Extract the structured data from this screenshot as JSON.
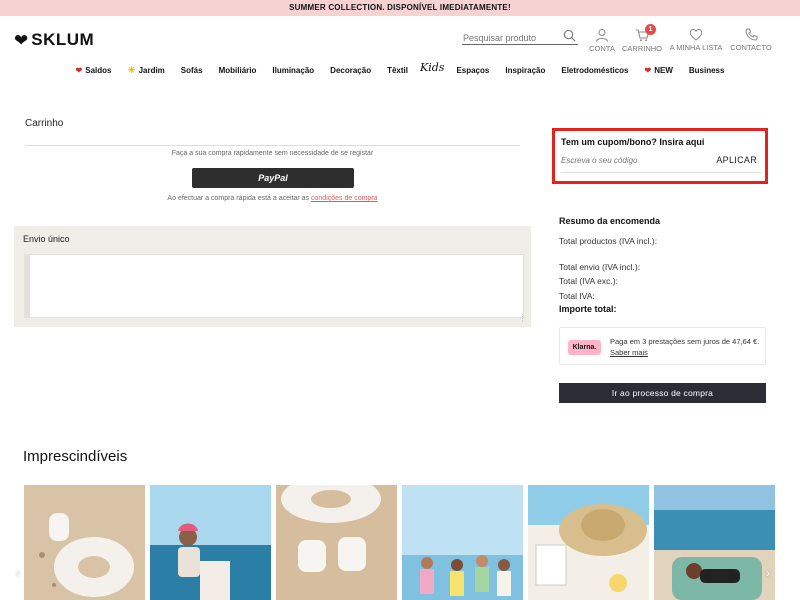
{
  "promo": {
    "text": "SUMMER COLLECTION. DISPONÍVEL IMEDIATAMENTE!"
  },
  "header": {
    "logo": "SKLUM",
    "search_placeholder": "Pesquisar produto",
    "account_label": "CONTA",
    "cart_label": "CARRINHO",
    "cart_count": "1",
    "wishlist_label": "A MINHA LISTA",
    "contact_label": "CONTACTO"
  },
  "nav": {
    "items": [
      {
        "label": "Saldos",
        "mark": "heart"
      },
      {
        "label": "Jardim",
        "mark": "sun"
      },
      {
        "label": "Sofás"
      },
      {
        "label": "Mobiliário"
      },
      {
        "label": "Iluminação"
      },
      {
        "label": "Decoração"
      },
      {
        "label": "Têxtil"
      },
      {
        "label": "Kids"
      },
      {
        "label": "Espaços"
      },
      {
        "label": "Inspiração"
      },
      {
        "label": "Eletrodomésticos"
      },
      {
        "label": "NEW",
        "mark": "heart"
      },
      {
        "label": "Business"
      }
    ]
  },
  "cart": {
    "title": "Carrinho",
    "quick_text": "Faça a sua compra rapidamente sem necessidade de se registar",
    "paypal_label": "PayPal",
    "terms_prefix": "Ao efectuar a compra rápida está a aceitar as ",
    "terms_link": "condições de compra"
  },
  "shipping": {
    "title": "Envio único"
  },
  "coupon": {
    "title": "Tem um cupom/bono? Insira aqui",
    "placeholder": "Escreva o seu código",
    "apply_label": "APLICAR"
  },
  "summary": {
    "title": "Resumo da encomenda",
    "lines": [
      "Total productos (IVA incl.):",
      "Total envio (IVA incl.):",
      "Total (IVA exc.):",
      "Total IVA:"
    ],
    "total_label": "Importe total:"
  },
  "klarna": {
    "logo": "Klarna.",
    "text": "Paga em 3 prestações sem juros de 47,64 €. ",
    "link": "Saber mais"
  },
  "checkout": {
    "label": "Ir ao processo de compra"
  },
  "essentials": {
    "title": "Imprescindíveis"
  },
  "colors": {
    "promo": "#f7d2d2",
    "accent_red": "#e6201d",
    "button_dark": "#2a2d34",
    "klarna_pink": "#ffb3c7"
  }
}
